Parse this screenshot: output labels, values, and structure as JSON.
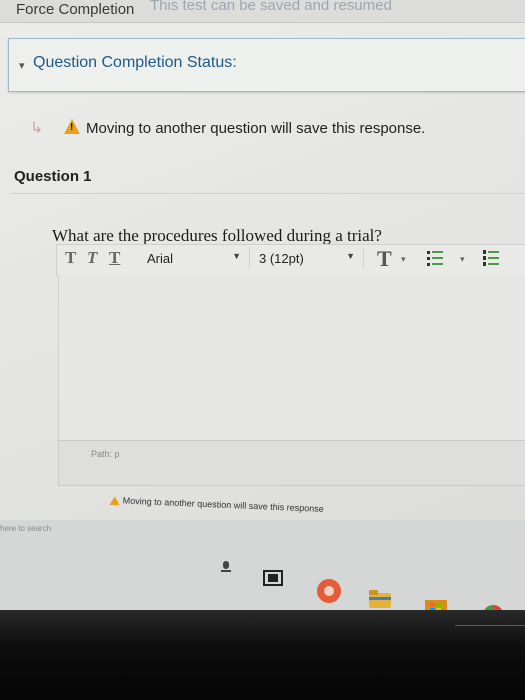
{
  "header": {
    "force_label": "Force Completion",
    "force_desc": "This test can be saved and resumed"
  },
  "status": {
    "toggle_glyph": "▾",
    "title": "Question Completion Status:"
  },
  "warning": {
    "arrow_glyph": "↳",
    "text": "Moving to another question will save this response."
  },
  "question": {
    "title": "Question 1",
    "prompt": "What are the procedures followed during a trial?"
  },
  "toolbar": {
    "bold_glyph": "T",
    "italic_glyph": "T",
    "underline_glyph": "T",
    "font_family": "Arial",
    "font_size": "3 (12pt)",
    "dropdown_glyph": "▼",
    "text_color_glyph": "T",
    "small_dropdown_glyph": "▾"
  },
  "editor": {
    "path_label": "Path: p"
  },
  "bottom_warning": {
    "text": "Moving to another question will save this response"
  },
  "taskbar": {
    "search_placeholder": "here to search"
  },
  "colors": {
    "accent_blue": "#1e5a8a",
    "warning_orange": "#e8a020",
    "list_green": "#4d9a4d"
  }
}
